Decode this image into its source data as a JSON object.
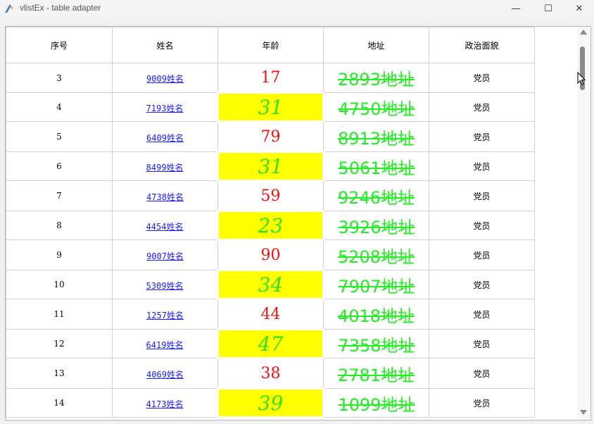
{
  "window": {
    "title": "vlistEx - table adapter",
    "min_glyph": "—",
    "max_glyph": "☐",
    "close_glyph": "✕"
  },
  "headers": [
    "序号",
    "姓名",
    "年龄",
    "地址",
    "政治面貌"
  ],
  "rows": [
    {
      "seq": "3",
      "name": "9009姓名",
      "age": "17",
      "address": "2893地址",
      "party": "党员",
      "highlight": false
    },
    {
      "seq": "4",
      "name": "7193姓名",
      "age": "31",
      "address": "4750地址",
      "party": "党员",
      "highlight": true
    },
    {
      "seq": "5",
      "name": "6409姓名",
      "age": "79",
      "address": "8913地址",
      "party": "党员",
      "highlight": false
    },
    {
      "seq": "6",
      "name": "8499姓名",
      "age": "31",
      "address": "5061地址",
      "party": "党员",
      "highlight": true
    },
    {
      "seq": "7",
      "name": "4738姓名",
      "age": "59",
      "address": "9246地址",
      "party": "党员",
      "highlight": false
    },
    {
      "seq": "8",
      "name": "4454姓名",
      "age": "23",
      "address": "3926地址",
      "party": "党员",
      "highlight": true
    },
    {
      "seq": "9",
      "name": "9007姓名",
      "age": "90",
      "address": "5208地址",
      "party": "党员",
      "highlight": false
    },
    {
      "seq": "10",
      "name": "5309姓名",
      "age": "34",
      "address": "7907地址",
      "party": "党员",
      "highlight": true
    },
    {
      "seq": "11",
      "name": "1257姓名",
      "age": "44",
      "address": "4018地址",
      "party": "党员",
      "highlight": false
    },
    {
      "seq": "12",
      "name": "6419姓名",
      "age": "47",
      "address": "7358地址",
      "party": "党员",
      "highlight": true
    },
    {
      "seq": "13",
      "name": "4069姓名",
      "age": "38",
      "address": "2781地址",
      "party": "党员",
      "highlight": false
    },
    {
      "seq": "14",
      "name": "4173姓名",
      "age": "39",
      "address": "1099地址",
      "party": "党员",
      "highlight": true
    }
  ],
  "colors": {
    "age_normal": "#ee1111",
    "age_highlight_bg": "#ffff00",
    "age_highlight_text": "#33e01a",
    "address": "#22ee22",
    "link": "#1a1aff"
  }
}
